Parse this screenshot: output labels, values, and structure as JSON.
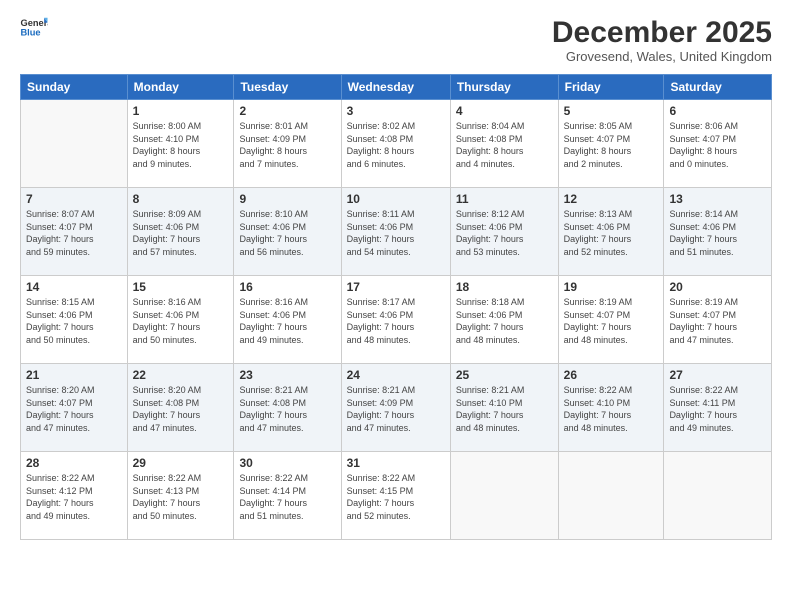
{
  "logo": {
    "line1": "General",
    "line2": "Blue"
  },
  "title": "December 2025",
  "location": "Grovesend, Wales, United Kingdom",
  "headers": [
    "Sunday",
    "Monday",
    "Tuesday",
    "Wednesday",
    "Thursday",
    "Friday",
    "Saturday"
  ],
  "weeks": [
    [
      {
        "num": "",
        "info": ""
      },
      {
        "num": "1",
        "info": "Sunrise: 8:00 AM\nSunset: 4:10 PM\nDaylight: 8 hours\nand 9 minutes."
      },
      {
        "num": "2",
        "info": "Sunrise: 8:01 AM\nSunset: 4:09 PM\nDaylight: 8 hours\nand 7 minutes."
      },
      {
        "num": "3",
        "info": "Sunrise: 8:02 AM\nSunset: 4:08 PM\nDaylight: 8 hours\nand 6 minutes."
      },
      {
        "num": "4",
        "info": "Sunrise: 8:04 AM\nSunset: 4:08 PM\nDaylight: 8 hours\nand 4 minutes."
      },
      {
        "num": "5",
        "info": "Sunrise: 8:05 AM\nSunset: 4:07 PM\nDaylight: 8 hours\nand 2 minutes."
      },
      {
        "num": "6",
        "info": "Sunrise: 8:06 AM\nSunset: 4:07 PM\nDaylight: 8 hours\nand 0 minutes."
      }
    ],
    [
      {
        "num": "7",
        "info": "Sunrise: 8:07 AM\nSunset: 4:07 PM\nDaylight: 7 hours\nand 59 minutes."
      },
      {
        "num": "8",
        "info": "Sunrise: 8:09 AM\nSunset: 4:06 PM\nDaylight: 7 hours\nand 57 minutes."
      },
      {
        "num": "9",
        "info": "Sunrise: 8:10 AM\nSunset: 4:06 PM\nDaylight: 7 hours\nand 56 minutes."
      },
      {
        "num": "10",
        "info": "Sunrise: 8:11 AM\nSunset: 4:06 PM\nDaylight: 7 hours\nand 54 minutes."
      },
      {
        "num": "11",
        "info": "Sunrise: 8:12 AM\nSunset: 4:06 PM\nDaylight: 7 hours\nand 53 minutes."
      },
      {
        "num": "12",
        "info": "Sunrise: 8:13 AM\nSunset: 4:06 PM\nDaylight: 7 hours\nand 52 minutes."
      },
      {
        "num": "13",
        "info": "Sunrise: 8:14 AM\nSunset: 4:06 PM\nDaylight: 7 hours\nand 51 minutes."
      }
    ],
    [
      {
        "num": "14",
        "info": "Sunrise: 8:15 AM\nSunset: 4:06 PM\nDaylight: 7 hours\nand 50 minutes."
      },
      {
        "num": "15",
        "info": "Sunrise: 8:16 AM\nSunset: 4:06 PM\nDaylight: 7 hours\nand 50 minutes."
      },
      {
        "num": "16",
        "info": "Sunrise: 8:16 AM\nSunset: 4:06 PM\nDaylight: 7 hours\nand 49 minutes."
      },
      {
        "num": "17",
        "info": "Sunrise: 8:17 AM\nSunset: 4:06 PM\nDaylight: 7 hours\nand 48 minutes."
      },
      {
        "num": "18",
        "info": "Sunrise: 8:18 AM\nSunset: 4:06 PM\nDaylight: 7 hours\nand 48 minutes."
      },
      {
        "num": "19",
        "info": "Sunrise: 8:19 AM\nSunset: 4:07 PM\nDaylight: 7 hours\nand 48 minutes."
      },
      {
        "num": "20",
        "info": "Sunrise: 8:19 AM\nSunset: 4:07 PM\nDaylight: 7 hours\nand 47 minutes."
      }
    ],
    [
      {
        "num": "21",
        "info": "Sunrise: 8:20 AM\nSunset: 4:07 PM\nDaylight: 7 hours\nand 47 minutes."
      },
      {
        "num": "22",
        "info": "Sunrise: 8:20 AM\nSunset: 4:08 PM\nDaylight: 7 hours\nand 47 minutes."
      },
      {
        "num": "23",
        "info": "Sunrise: 8:21 AM\nSunset: 4:08 PM\nDaylight: 7 hours\nand 47 minutes."
      },
      {
        "num": "24",
        "info": "Sunrise: 8:21 AM\nSunset: 4:09 PM\nDaylight: 7 hours\nand 47 minutes."
      },
      {
        "num": "25",
        "info": "Sunrise: 8:21 AM\nSunset: 4:10 PM\nDaylight: 7 hours\nand 48 minutes."
      },
      {
        "num": "26",
        "info": "Sunrise: 8:22 AM\nSunset: 4:10 PM\nDaylight: 7 hours\nand 48 minutes."
      },
      {
        "num": "27",
        "info": "Sunrise: 8:22 AM\nSunset: 4:11 PM\nDaylight: 7 hours\nand 49 minutes."
      }
    ],
    [
      {
        "num": "28",
        "info": "Sunrise: 8:22 AM\nSunset: 4:12 PM\nDaylight: 7 hours\nand 49 minutes."
      },
      {
        "num": "29",
        "info": "Sunrise: 8:22 AM\nSunset: 4:13 PM\nDaylight: 7 hours\nand 50 minutes."
      },
      {
        "num": "30",
        "info": "Sunrise: 8:22 AM\nSunset: 4:14 PM\nDaylight: 7 hours\nand 51 minutes."
      },
      {
        "num": "31",
        "info": "Sunrise: 8:22 AM\nSunset: 4:15 PM\nDaylight: 7 hours\nand 52 minutes."
      },
      {
        "num": "",
        "info": ""
      },
      {
        "num": "",
        "info": ""
      },
      {
        "num": "",
        "info": ""
      }
    ]
  ]
}
